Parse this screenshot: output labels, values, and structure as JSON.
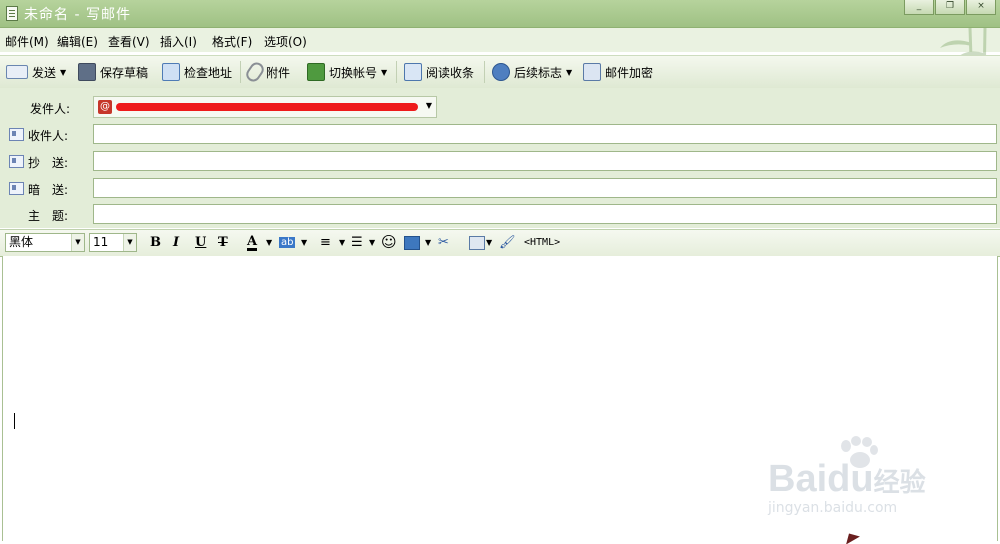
{
  "window": {
    "title": "未命名 - 写邮件",
    "buttons": [
      "_",
      "❐",
      "×"
    ]
  },
  "menu": [
    {
      "label": "邮件(M)"
    },
    {
      "label": "编辑(E)"
    },
    {
      "label": "查看(V)"
    },
    {
      "label": "插入(I)"
    },
    {
      "label": "格式(F)"
    },
    {
      "label": "选项(O)"
    }
  ],
  "toolbar": [
    {
      "label": "发送",
      "icon": "send-icon",
      "dropdown": true
    },
    {
      "label": "保存草稿",
      "icon": "save-draft-icon"
    },
    {
      "label": "检查地址",
      "icon": "check-address-icon"
    },
    {
      "label": "附件",
      "icon": "paperclip-icon"
    },
    {
      "label": "切换帐号",
      "icon": "switch-account-icon",
      "dropdown": true
    },
    {
      "label": "阅读收条",
      "icon": "read-receipt-icon"
    },
    {
      "label": "后续标志",
      "icon": "follow-up-flag-icon",
      "dropdown": true
    },
    {
      "label": "邮件加密",
      "icon": "encrypt-icon"
    }
  ],
  "fields": {
    "from_label": "发件人:",
    "to_label": "收件人:",
    "cc_label": "抄　送:",
    "bcc_label": "暗　送:",
    "subject_label": "主　题:"
  },
  "format": {
    "font": "黑体",
    "size": "11",
    "bold": "B",
    "italic": "I",
    "underline": "U",
    "strike": "T",
    "font_color": "A",
    "highlight": "ab",
    "html": "<HTML>"
  },
  "watermark": {
    "brand_a": "Bai",
    "brand_b": "du",
    "suffix": "经验",
    "url": "jingyan.baidu.com"
  },
  "colors": {
    "accent": "#9fc184",
    "redaction": "#ee1b1b"
  }
}
